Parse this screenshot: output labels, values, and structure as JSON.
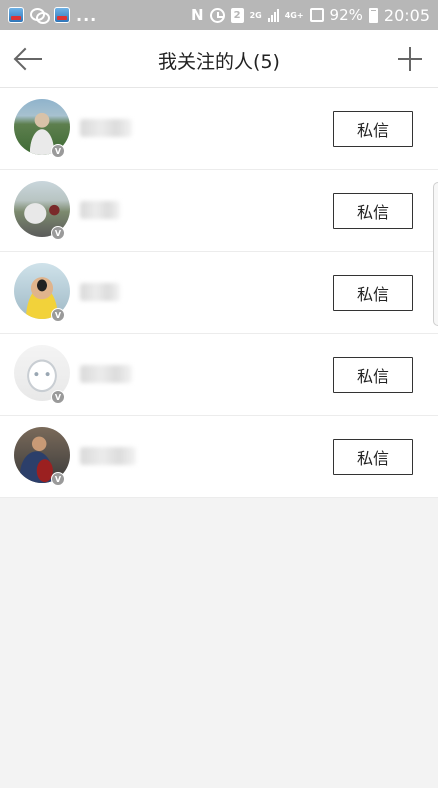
{
  "status_bar": {
    "more": "...",
    "sim_slot": "2",
    "network": "4G+",
    "signal_label": "2G",
    "battery": "92%",
    "time": "20:05",
    "icons": [
      "app-icon",
      "wechat-icon",
      "nfc-icon",
      "alarm-icon",
      "signal-icon",
      "battery-icon"
    ]
  },
  "nav": {
    "title": "我关注的人(5)",
    "back_icon": "arrow-left",
    "add_icon": "plus"
  },
  "follow_list": [
    {
      "message_button": "私信",
      "badge": "V",
      "avatar": "person-outdoor-green"
    },
    {
      "message_button": "私信",
      "badge": "V",
      "avatar": "car-road"
    },
    {
      "message_button": "私信",
      "badge": "V",
      "avatar": "man-sunglasses"
    },
    {
      "message_button": "私信",
      "badge": "V",
      "avatar": "default-bunny"
    },
    {
      "message_button": "私信",
      "badge": "V",
      "avatar": "man-certificate"
    }
  ]
}
